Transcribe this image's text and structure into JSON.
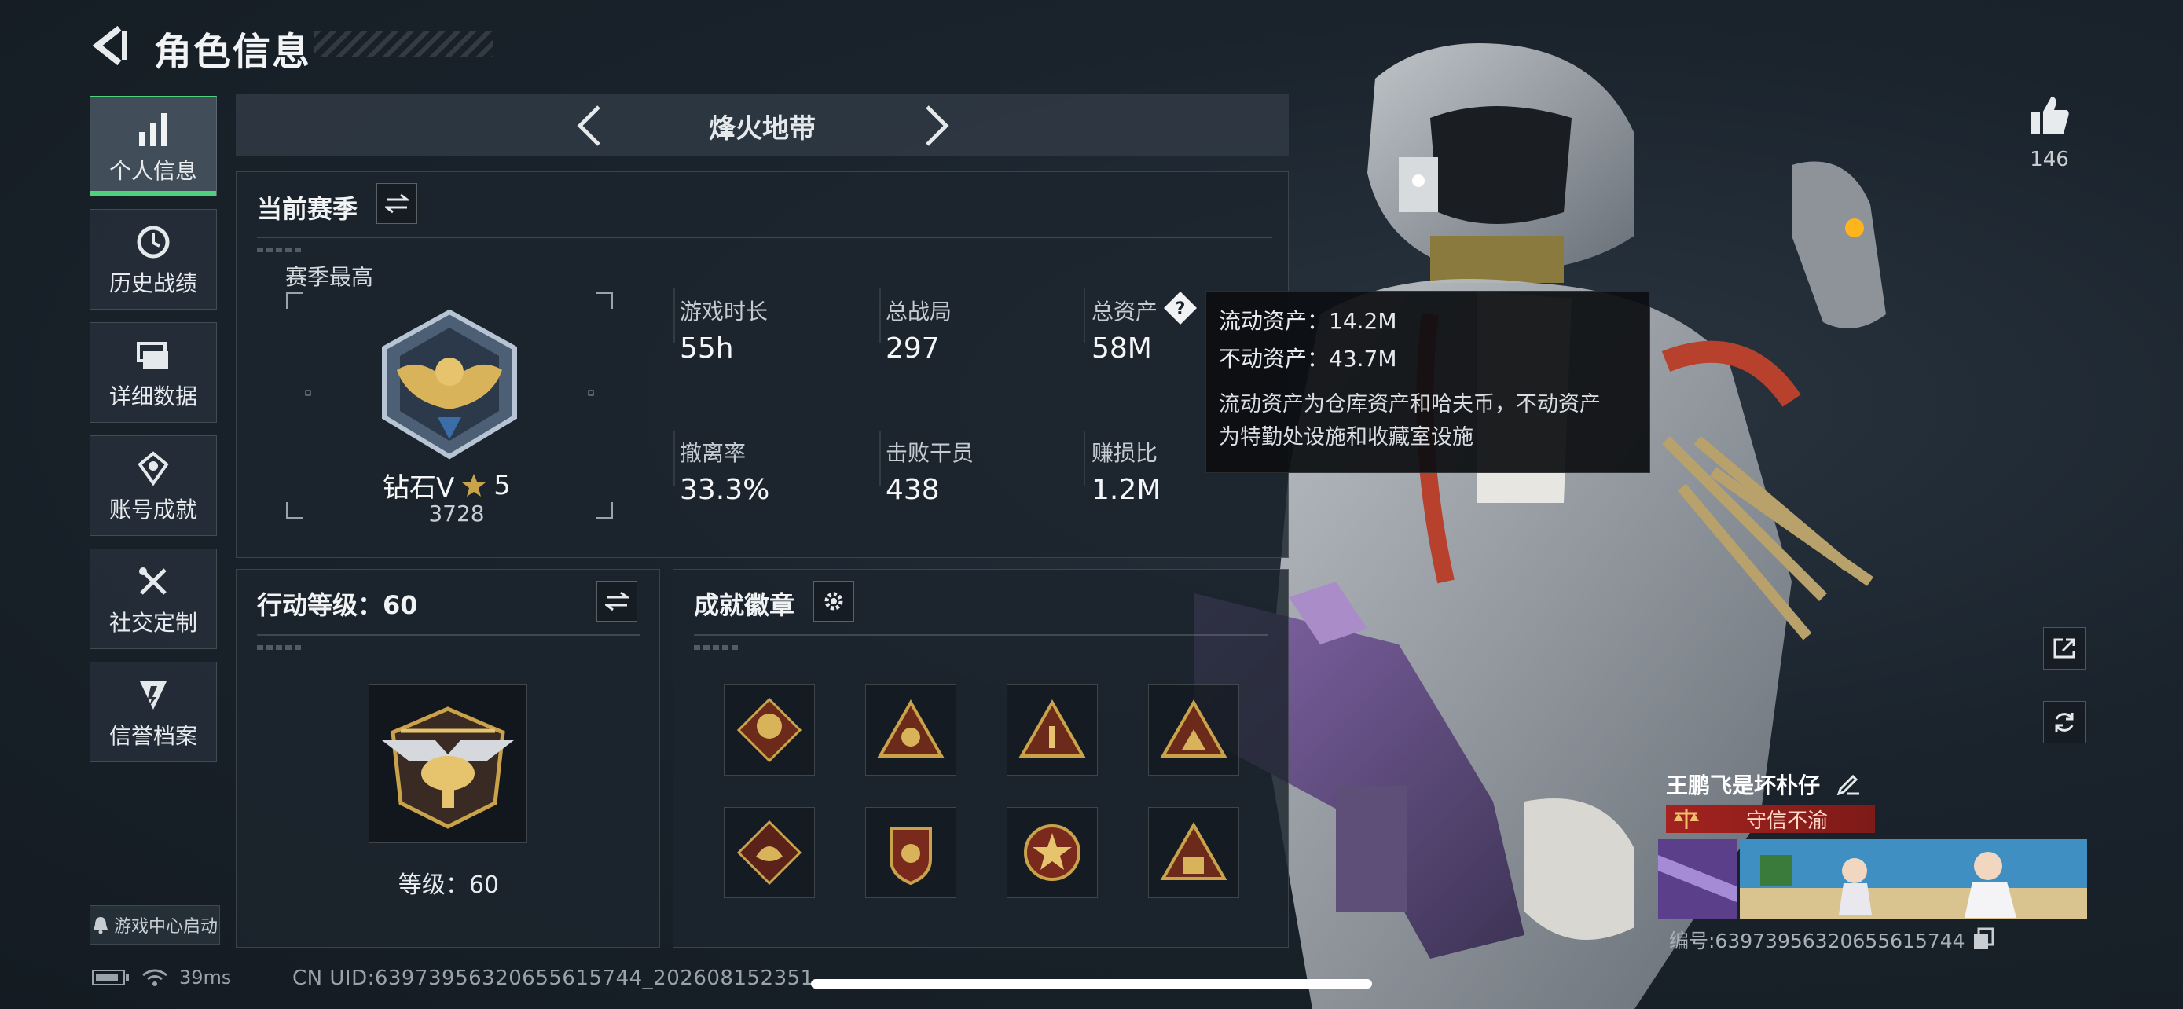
{
  "header": {
    "title": "角色信息"
  },
  "sidebar": {
    "items": [
      {
        "label": "个人信息",
        "icon": "bar-chart-icon",
        "active": true
      },
      {
        "label": "历史战绩",
        "icon": "history-clock-icon"
      },
      {
        "label": "详细数据",
        "icon": "folder-icon"
      },
      {
        "label": "账号成就",
        "icon": "achievement-icon"
      },
      {
        "label": "社交定制",
        "icon": "tools-icon"
      },
      {
        "label": "信誉档案",
        "icon": "reputation-icon"
      }
    ],
    "launch_label": "游戏中心启动"
  },
  "mode_selector": {
    "label": "烽火地带"
  },
  "season": {
    "title": "当前赛季",
    "best_label": "赛季最高",
    "rank_name": "钻石V",
    "rank_stars": "5",
    "rank_score": "3728",
    "stats": [
      {
        "label": "游戏时长",
        "value": "55h"
      },
      {
        "label": "总战局",
        "value": "297"
      },
      {
        "label": "总资产",
        "value": "58M"
      },
      {
        "label": "撤离率",
        "value": "33.3%"
      },
      {
        "label": "击败干员",
        "value": "438"
      },
      {
        "label": "赚损比",
        "value": "1.2M"
      }
    ]
  },
  "tooltip": {
    "line1": "流动资产：14.2M",
    "line2": "不动资产：43.7M",
    "desc1": "流动资产为仓库资产和哈夫币，不动资产",
    "desc2": "为特勤处设施和收藏室设施"
  },
  "action_level": {
    "title": "行动等级：60",
    "level_text": "等级：60"
  },
  "badges": {
    "title": "成就徽章",
    "items": [
      "badge-1",
      "badge-2",
      "badge-3",
      "badge-4",
      "badge-5",
      "badge-6",
      "badge-7",
      "badge-8"
    ]
  },
  "player": {
    "likes": "146",
    "name": "王鹏飞是坏朴仔",
    "honor": "守信不渝",
    "id_line": "编号:63973956320655615744"
  },
  "status": {
    "ping": "39ms",
    "uid": "CN UID:63973956320655615744_202608152351"
  },
  "colors": {
    "accent_green": "#4ed17a",
    "honor_red": "#a4221f",
    "gold": "#c9a24a"
  }
}
